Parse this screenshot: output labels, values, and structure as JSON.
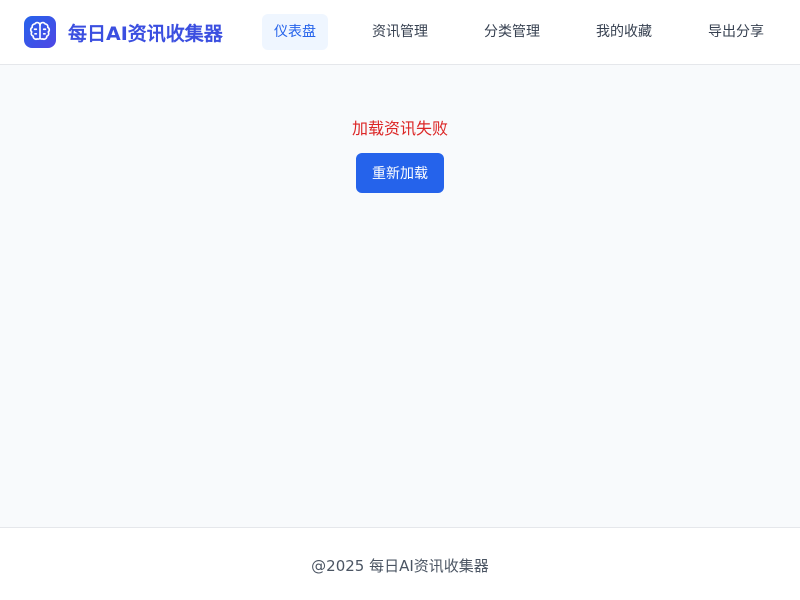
{
  "app": {
    "title": "每日AI资讯收集器",
    "logo_icon": "brain-icon",
    "brand_color": "#2563eb"
  },
  "nav": {
    "items": [
      {
        "label": "仪表盘",
        "active": true
      },
      {
        "label": "资讯管理",
        "active": false
      },
      {
        "label": "分类管理",
        "active": false
      },
      {
        "label": "我的收藏",
        "active": false
      },
      {
        "label": "导出分享",
        "active": false
      }
    ]
  },
  "main": {
    "error_message": "加载资讯失败",
    "error_color": "#dc2626",
    "reload_label": "重新加载"
  },
  "footer": {
    "text": "@2025 每日AI资讯收集器"
  }
}
